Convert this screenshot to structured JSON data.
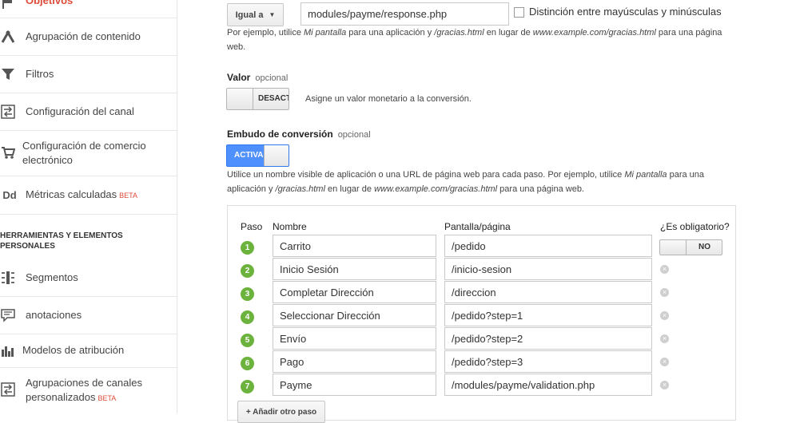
{
  "sidebar": {
    "items_top": [
      {
        "label": "Objetivos",
        "icon": "flag-icon"
      },
      {
        "label": "Agrupación de contenido",
        "icon": "content-grouping-icon"
      },
      {
        "label": "Filtros",
        "icon": "filter-icon"
      },
      {
        "label": "Configuración del canal",
        "icon": "channel-settings-icon"
      },
      {
        "label": "Configuración de comercio electrónico",
        "icon": "cart-icon"
      },
      {
        "label": "Métricas calculadas",
        "icon": "calculated-metrics-icon",
        "badge": "BETA"
      }
    ],
    "section_title": "HERRAMIENTAS Y ELEMENTOS PERSONALES",
    "items_bottom": [
      {
        "label": "Segmentos",
        "icon": "segments-icon"
      },
      {
        "label": "anotaciones",
        "icon": "annotations-icon"
      },
      {
        "label": "Modelos de atribución",
        "icon": "attribution-icon"
      },
      {
        "label": "Agrupaciones de canales personalizados",
        "icon": "custom-channels-icon",
        "badge": "BETA"
      }
    ]
  },
  "destination": {
    "match_type": "Igual a",
    "url_value": "modules/payme/response.php",
    "case_sensitive_label": "Distinción entre mayúsculas y minúsculas",
    "hint_prefix": "Por ejemplo, utilice ",
    "hint_em1": "Mi pantalla",
    "hint_mid1": " para una aplicación y ",
    "hint_em2": "/gracias.html",
    "hint_mid2": " en lugar de ",
    "hint_em3": "www.example.com/gracias.html",
    "hint_suffix": " para una página web."
  },
  "value": {
    "title": "Valor",
    "optional": "opcional",
    "toggle_label": "DESACT",
    "description": "Asigne un valor monetario a la conversión."
  },
  "funnel": {
    "title": "Embudo de conversión",
    "optional": "opcional",
    "toggle_label": "ACTIVA",
    "hint_prefix": "Utilice un nombre visible de aplicación o una URL de página web para cada paso. Por ejemplo, utilice ",
    "hint_em1": "Mi pantalla",
    "hint_mid1": " para una aplicación y ",
    "hint_em2": "/gracias.html",
    "hint_mid2": " en lugar de ",
    "hint_em3": "www.example.com/gracias.html",
    "hint_suffix": " para una página web.",
    "col_step": "Paso",
    "col_name": "Nombre",
    "col_screen": "Pantalla/página",
    "col_required": "¿Es obligatorio?",
    "required_toggle_label": "NO",
    "steps": [
      {
        "num": "1",
        "name": "Carrito",
        "page": "/pedido"
      },
      {
        "num": "2",
        "name": "Inicio Sesión",
        "page": "/inicio-sesion"
      },
      {
        "num": "3",
        "name": "Completar Dirección",
        "page": "/direccion"
      },
      {
        "num": "4",
        "name": "Seleccionar Dirección",
        "page": "/pedido?step=1"
      },
      {
        "num": "5",
        "name": "Envío",
        "page": "/pedido?step=2"
      },
      {
        "num": "6",
        "name": "Pago",
        "page": "/pedido?step=3"
      },
      {
        "num": "7",
        "name": "Payme",
        "page": "/modules/payme/validation.php"
      }
    ],
    "add_step_label": "+ Añadir otro paso"
  },
  "colors": {
    "accent": "#4d90fe",
    "step_green": "#6cb33e",
    "beta": "#dd4b39"
  }
}
